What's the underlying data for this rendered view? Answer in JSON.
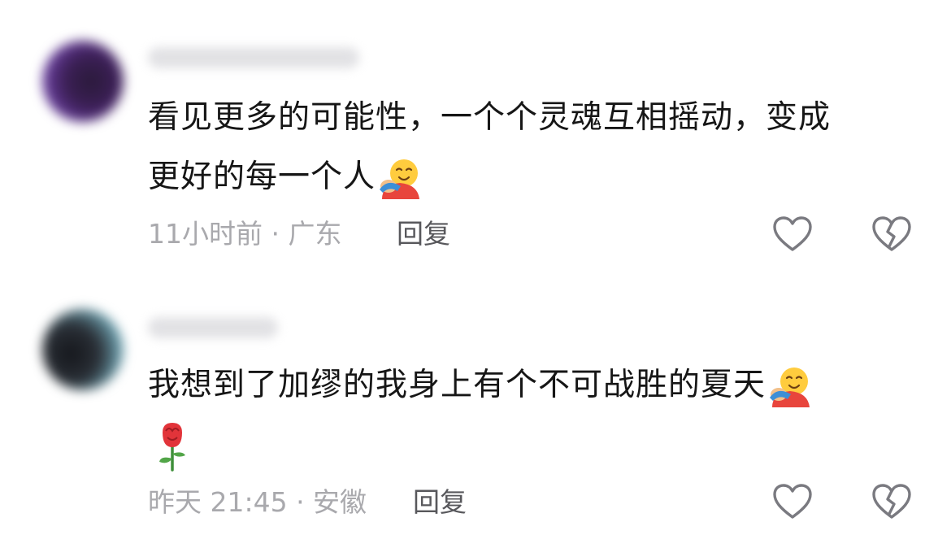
{
  "comments": [
    {
      "avatar": "blurred-avatar",
      "username": "",
      "text_line1": "看见更多的可能性，一个个灵魂互相摇动，变成",
      "text_line2": "更好的每一个人",
      "emoji": "hugging-face-icon",
      "meta": "11小时前 · 广东",
      "reply_label": "回复",
      "like_icon": "heart-outline-icon",
      "dislike_icon": "broken-heart-icon"
    },
    {
      "avatar": "blurred-avatar",
      "username": "",
      "text_line1": "我想到了加缪的我身上有个不可战胜的夏天",
      "emoji1": "hugging-face-icon",
      "emoji2": "rose-icon",
      "meta": "昨天 21:45 · 安徽",
      "reply_label": "回复",
      "like_icon": "heart-outline-icon",
      "dislike_icon": "broken-heart-icon"
    }
  ],
  "colors": {
    "text": "#161616",
    "meta": "#a9a9ad",
    "reply": "#58585c",
    "icon_stroke": "#7a7a80"
  }
}
